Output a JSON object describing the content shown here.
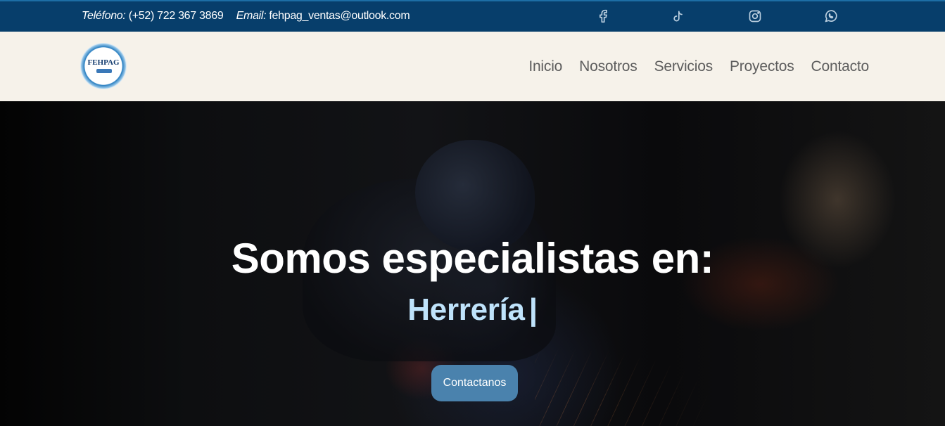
{
  "topbar": {
    "phone_label": "Teléfono:",
    "phone_value": "(+52) 722 367 3869",
    "email_label": "Email:",
    "email_value": "fehpag_ventas@outlook.com",
    "social_icons": [
      "facebook-icon",
      "tiktok-icon",
      "instagram-icon",
      "whatsapp-icon"
    ]
  },
  "logo": {
    "text": "FEHPAG"
  },
  "nav": {
    "items": [
      "Inicio",
      "Nosotros",
      "Servicios",
      "Proyectos",
      "Contacto"
    ]
  },
  "hero": {
    "title": "Somos especialistas en:",
    "subtitle": "Herrería",
    "cursor": "|",
    "cta_label": "Contactanos"
  },
  "colors": {
    "topbar_bg": "#073e6b",
    "navbar_bg": "#f6f2ea",
    "accent": "#4a82ad",
    "subtitle": "#bfe3fb"
  }
}
